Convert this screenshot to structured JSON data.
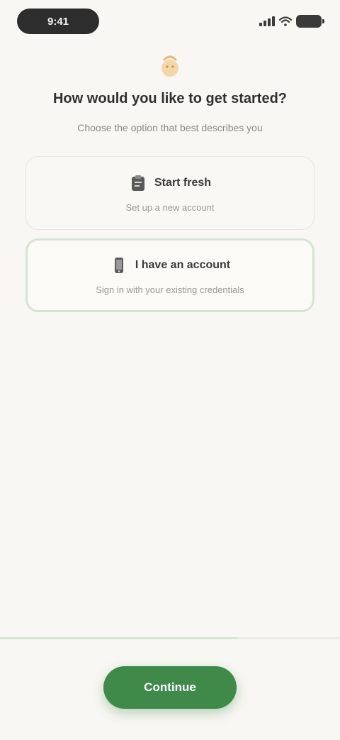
{
  "status_bar": {
    "time": "9:41"
  },
  "header": {
    "icon": "hand-wave-icon",
    "title": "How would you like to get started?",
    "subtitle": "Choose the option that best describes you"
  },
  "options": [
    {
      "icon": "clipboard-icon",
      "label": "Start fresh",
      "description": "Set up a new account",
      "selected": false
    },
    {
      "icon": "phone-icon",
      "label": "I have an account",
      "description": "Sign in with your existing credentials",
      "selected": true
    }
  ],
  "footer": {
    "continue_label": "Continue",
    "progress": 0.7
  },
  "colors": {
    "accent": "#3f8a49",
    "background": "#f8f7f3",
    "selected_border": "#d6e3d2"
  }
}
